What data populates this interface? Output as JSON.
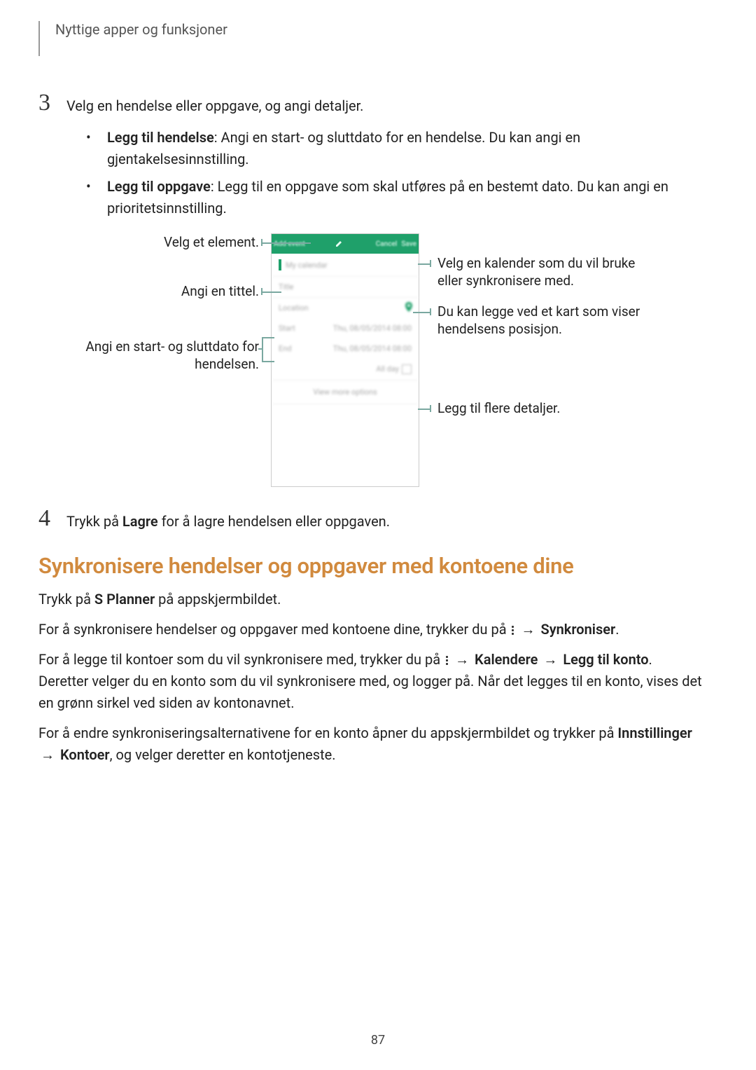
{
  "header": "Nyttige apper og funksjoner",
  "step3": {
    "num": "3",
    "intro": "Velg en hendelse eller oppgave, og angi detaljer.",
    "bullets": [
      {
        "bold": "Legg til hendelse",
        "rest": ": Angi en start- og sluttdato for en hendelse. Du kan angi en gjentakelsesinnstilling."
      },
      {
        "bold": "Legg til oppgave",
        "rest": ": Legg til en oppgave som skal utføres på en bestemt dato. Du kan angi en prioritetsinnstilling."
      }
    ]
  },
  "step4": {
    "num": "4",
    "text_pre": "Trykk på ",
    "text_bold": "Lagre",
    "text_post": " for å lagre hendelsen eller oppgaven."
  },
  "diagram": {
    "callouts": {
      "selectItem": "Velg et element.",
      "enterTitle": "Angi en tittel.",
      "startEnd1": "Angi en start- og sluttdato for",
      "startEnd2": "hendelsen.",
      "selectCal1": "Velg en kalender som du vil bruke",
      "selectCal2": "eller synkronisere med.",
      "attachMap1": "Du kan legge ved et kart som viser",
      "attachMap2": "hendelsens posisjon.",
      "addMore": "Legg til flere detaljer."
    },
    "labels": {
      "barL": "Add event",
      "barR1": "Cancel",
      "barR2": "Save",
      "myCal": "My calendar",
      "title": "Title",
      "location": "Location",
      "start": "Start",
      "end": "End",
      "date": "Thu, 08/05/2014  08:00",
      "allday": "All day",
      "more": "View more options"
    }
  },
  "section2": {
    "heading": "Synkronisere hendelser og oppgaver med kontoene dine",
    "p1_pre": "Trykk på ",
    "p1_bold": "S Planner",
    "p1_post": " på appskjermbildet.",
    "p2_pre": "For å synkronisere hendelser og oppgaver med kontoene dine, trykker du på ",
    "p2_arrow": "→",
    "p2_bold": "Synkroniser",
    "p2_end": ".",
    "p3_a": "For å legge til kontoer som du vil synkronisere med, trykker du på ",
    "p3_b": "Kalendere",
    "p3_c": "Legg til konto",
    "p3_d": ". Deretter velger du en konto som du vil synkronisere med, og logger på. Når det legges til en konto, vises det en grønn sirkel ved siden av kontonavnet.",
    "p4_a": "For å endre synkroniseringsalternativene for en konto åpner du appskjermbildet og trykker på ",
    "p4_b": "Innstillinger",
    "p4_c": "Kontoer",
    "p4_d": ", og velger deretter en kontotjeneste."
  },
  "pagenum": "87"
}
